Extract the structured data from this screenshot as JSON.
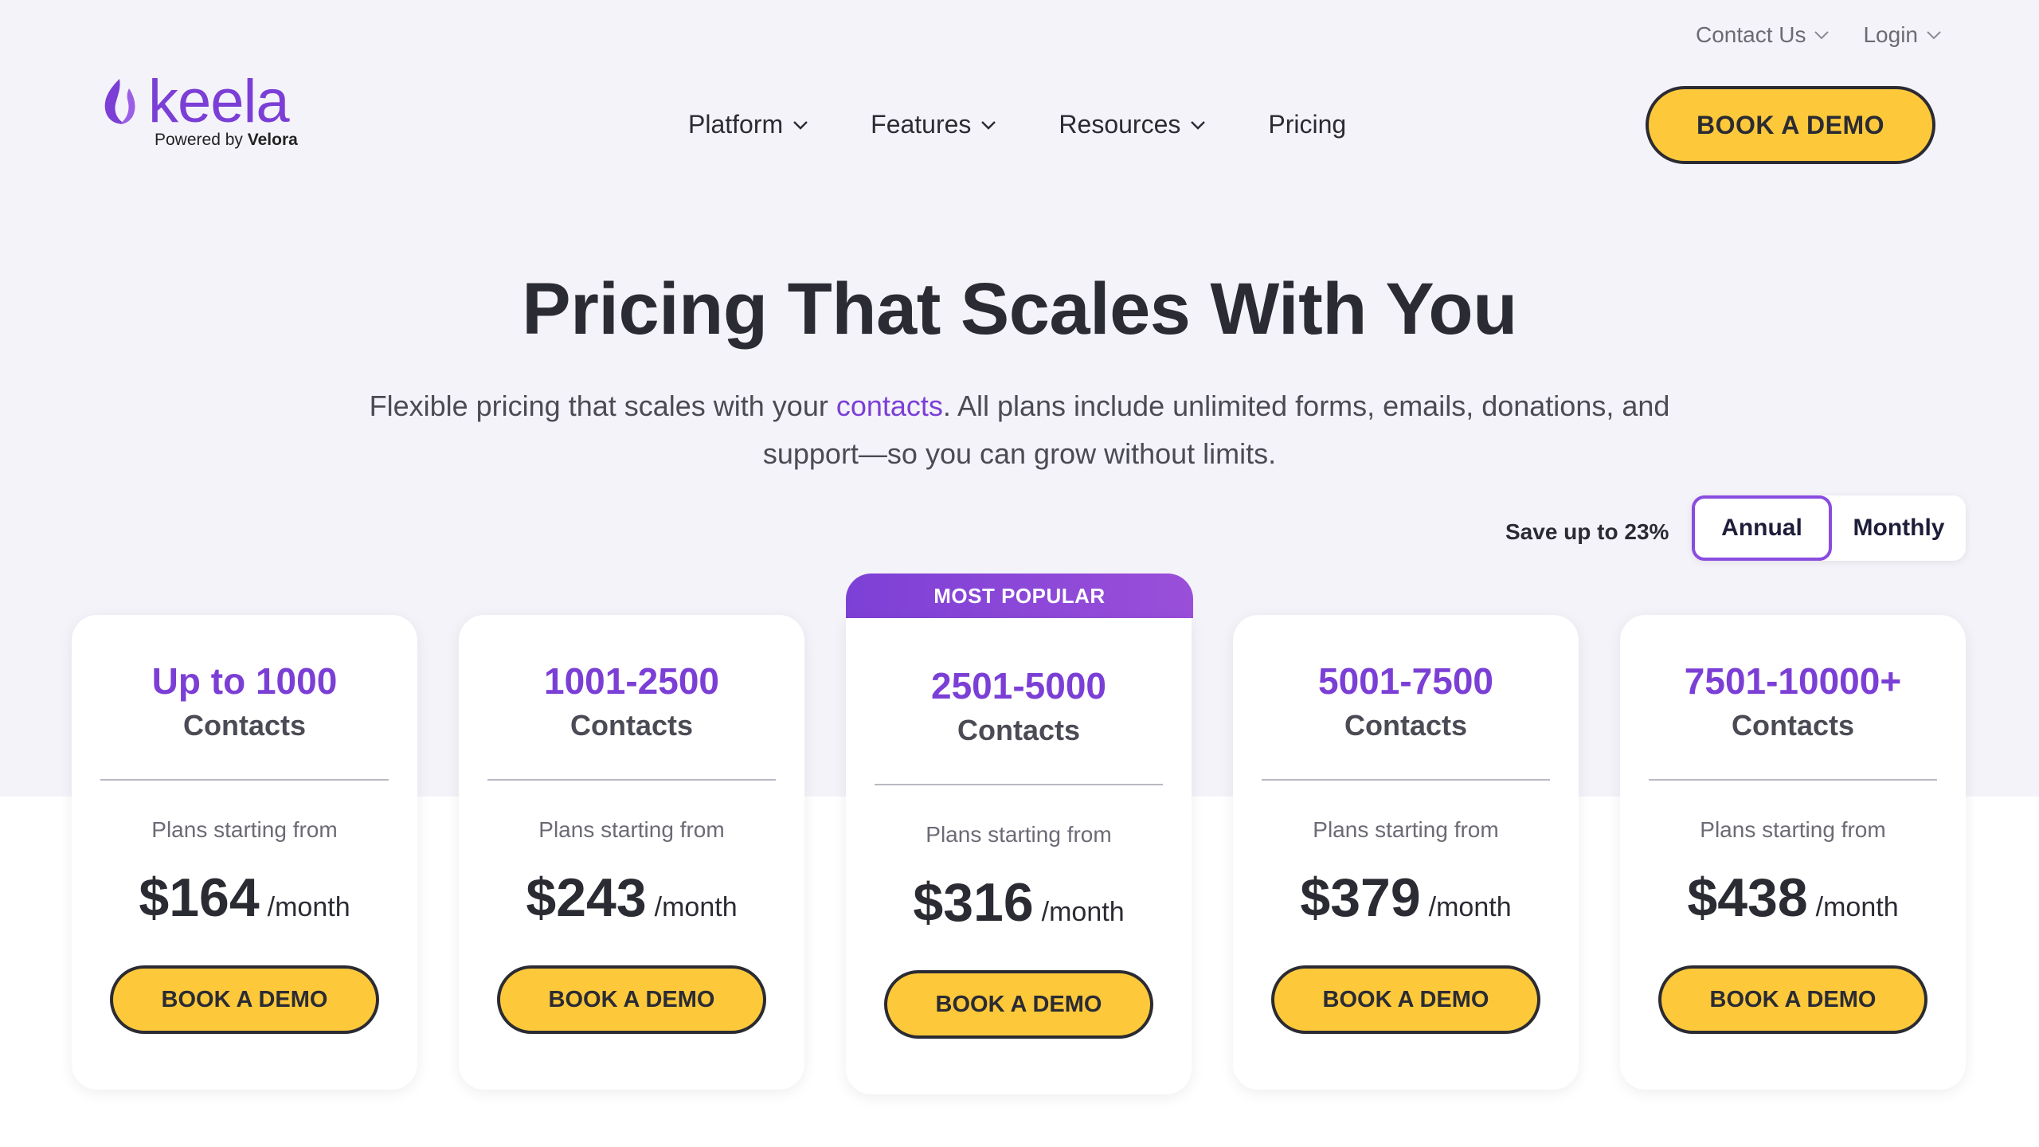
{
  "header": {
    "utility_links": [
      {
        "label": "Contact Us"
      },
      {
        "label": "Login"
      }
    ],
    "logo": {
      "word": "keela",
      "sub_prefix": "Powered by",
      "sub_brand": "Velora"
    },
    "nav": [
      {
        "label": "Platform",
        "dropdown": true
      },
      {
        "label": "Features",
        "dropdown": true
      },
      {
        "label": "Resources",
        "dropdown": true
      },
      {
        "label": "Pricing",
        "dropdown": false
      }
    ],
    "cta_label": "BOOK A DEMO"
  },
  "hero": {
    "title": "Pricing That Scales With You",
    "subtitle_before": "Flexible pricing that scales with your ",
    "subtitle_link": "contacts",
    "subtitle_after": ". All plans include unlimited forms, emails, donations, and support—so you can grow without limits."
  },
  "billing": {
    "save_label": "Save up to 23%",
    "options": [
      "Annual",
      "Monthly"
    ],
    "selected": "Annual"
  },
  "popular_label": "MOST POPULAR",
  "plans": [
    {
      "range": "Up to 1000",
      "unit": "Contacts",
      "from_label": "Plans starting from",
      "price": "$164",
      "per": "/month",
      "button": "BOOK A DEMO"
    },
    {
      "range": "1001-2500",
      "unit": "Contacts",
      "from_label": "Plans starting from",
      "price": "$243",
      "per": "/month",
      "button": "BOOK A DEMO"
    },
    {
      "range": "2501-5000",
      "unit": "Contacts",
      "from_label": "Plans starting from",
      "price": "$316",
      "per": "/month",
      "button": "BOOK A DEMO"
    },
    {
      "range": "5001-7500",
      "unit": "Contacts",
      "from_label": "Plans starting from",
      "price": "$379",
      "per": "/month",
      "button": "BOOK A DEMO"
    },
    {
      "range": "7501-10000+",
      "unit": "Contacts",
      "from_label": "Plans starting from",
      "price": "$438",
      "per": "/month",
      "button": "BOOK A DEMO"
    }
  ],
  "colors": {
    "brand_purple": "#7b3fd6",
    "cta_yellow": "#fdc93a",
    "text_dark": "#2b2b33",
    "hero_bg": "#f4f3f9"
  }
}
